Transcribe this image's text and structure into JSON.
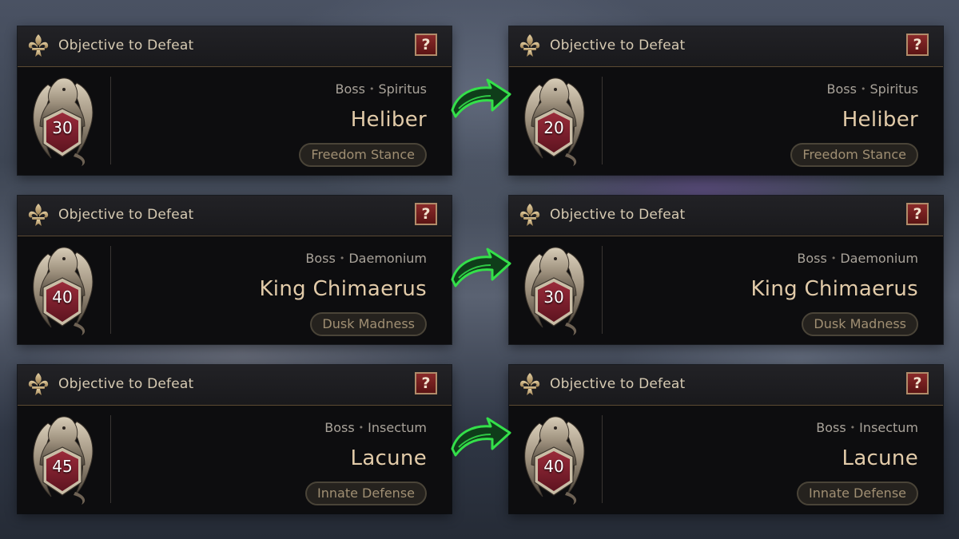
{
  "accent": {
    "gold": "#e2cba9",
    "help_red": "#8a2a2a",
    "arrow_green": "#37e14a"
  },
  "icons": {
    "header": "fleur-de-lis-icon",
    "help": "question-mark-icon",
    "badge": "gargoyle-crest-icon",
    "transition": "green-arrow-icon"
  },
  "panels": [
    {
      "header": "Objective to Defeat",
      "help": "?",
      "level": "30",
      "type": "Boss",
      "faction": "Spiritus",
      "name": "Heliber",
      "trait": "Freedom Stance"
    },
    {
      "header": "Objective to Defeat",
      "help": "?",
      "level": "20",
      "type": "Boss",
      "faction": "Spiritus",
      "name": "Heliber",
      "trait": "Freedom Stance"
    },
    {
      "header": "Objective to Defeat",
      "help": "?",
      "level": "40",
      "type": "Boss",
      "faction": "Daemonium",
      "name": "King Chimaerus",
      "trait": "Dusk Madness"
    },
    {
      "header": "Objective to Defeat",
      "help": "?",
      "level": "30",
      "type": "Boss",
      "faction": "Daemonium",
      "name": "King Chimaerus",
      "trait": "Dusk Madness"
    },
    {
      "header": "Objective to Defeat",
      "help": "?",
      "level": "45",
      "type": "Boss",
      "faction": "Insectum",
      "name": "Lacune",
      "trait": "Innate Defense"
    },
    {
      "header": "Objective to Defeat",
      "help": "?",
      "level": "40",
      "type": "Boss",
      "faction": "Insectum",
      "name": "Lacune",
      "trait": "Innate Defense"
    }
  ]
}
